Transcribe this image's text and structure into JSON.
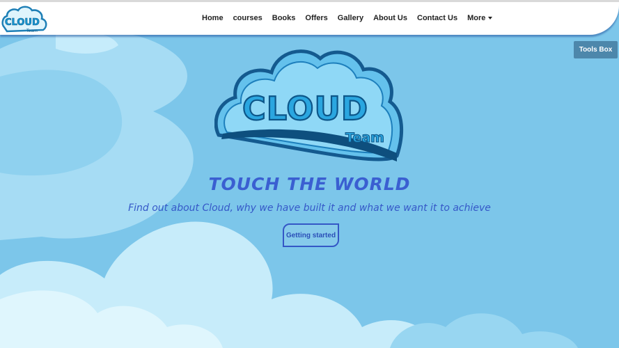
{
  "brand": {
    "logo_word": "CLOUD",
    "logo_sub": "Team"
  },
  "nav": {
    "items": [
      {
        "label": "Home"
      },
      {
        "label": "courses"
      },
      {
        "label": "Books"
      },
      {
        "label": "Offers"
      },
      {
        "label": "Gallery"
      },
      {
        "label": "About Us"
      },
      {
        "label": "Contact Us"
      },
      {
        "label": "More"
      }
    ],
    "more_icon": "caret-down-icon"
  },
  "tools_box": {
    "label": "Tools Box"
  },
  "hero": {
    "title": "TOUCH THE WORLD",
    "subtitle": "Find out about Cloud, why we have built it and what we want it to achieve",
    "cta_label": "Getting started"
  },
  "colors": {
    "sky": "#7cc6ea",
    "cloud_light": "#b9e6f8",
    "cloud_white": "#d8f3fc",
    "accent": "#3a5fd1",
    "tools_box": "#4d87ab"
  }
}
